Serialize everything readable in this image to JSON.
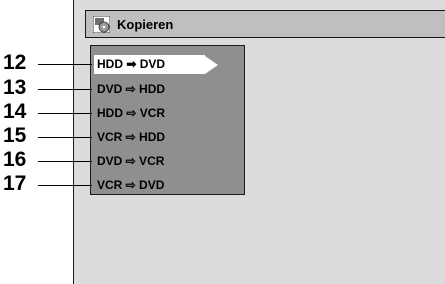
{
  "title": "Kopieren",
  "title_icon": "copy-disc-icon",
  "menu": {
    "items": [
      {
        "label": "HDD ➡ DVD",
        "callout": "12",
        "selected": true
      },
      {
        "label": "DVD ⇨ HDD",
        "callout": "13",
        "selected": false
      },
      {
        "label": "HDD ⇨ VCR",
        "callout": "14",
        "selected": false
      },
      {
        "label": "VCR ⇨ HDD",
        "callout": "15",
        "selected": false
      },
      {
        "label": "DVD ⇨ VCR",
        "callout": "16",
        "selected": false
      },
      {
        "label": "VCR ⇨ DVD",
        "callout": "17",
        "selected": false
      }
    ]
  },
  "colors": {
    "screen_bg": "#dcdcdc",
    "title_bar": "#bfbfbf",
    "menu_bg": "#8f8f8f",
    "selection": "#ffffff"
  }
}
